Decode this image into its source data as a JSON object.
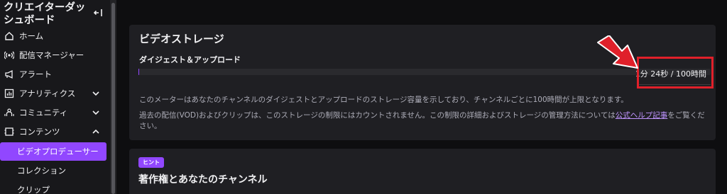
{
  "sidebar": {
    "title": "クリエイターダッシュボード",
    "items": [
      {
        "label": "ホーム",
        "icon": "home-icon"
      },
      {
        "label": "配信マネージャー",
        "icon": "broadcast-icon"
      },
      {
        "label": "アラート",
        "icon": "megaphone-icon"
      },
      {
        "label": "アナリティクス",
        "icon": "analytics-icon",
        "expanded": false
      },
      {
        "label": "コミュニティ",
        "icon": "community-icon",
        "expanded": false
      },
      {
        "label": "コンテンツ",
        "icon": "content-icon",
        "expanded": true
      }
    ],
    "subitems": [
      {
        "label": "ビデオプロデューサー",
        "active": true
      },
      {
        "label": "コレクション",
        "active": false
      },
      {
        "label": "クリップ",
        "active": false
      }
    ]
  },
  "storage_card": {
    "title": "ビデオストレージ",
    "section_label": "ダイジェスト＆アップロード",
    "usage": "1分 24秒 / 100時間",
    "usage_fraction": 0.0002,
    "desc1": "このメーターはあなたのチャンネルのダイジェストとアップロードのストレージ容量を示しており、チャンネルごとに100時間が上限となります。",
    "desc2_prefix": "過去の配信(VOD)およびクリップは、このストレージの制限にはカウントされません。この制限の詳細およびストレージの管理方法については",
    "desc2_link": "公式ヘルプ記事",
    "desc2_suffix": "をご覧ください。"
  },
  "copyright_card": {
    "badge": "ヒント",
    "title": "著作権とあなたのチャンネル"
  },
  "colors": {
    "accent": "#9147ff",
    "annotation": "#e0202a"
  }
}
